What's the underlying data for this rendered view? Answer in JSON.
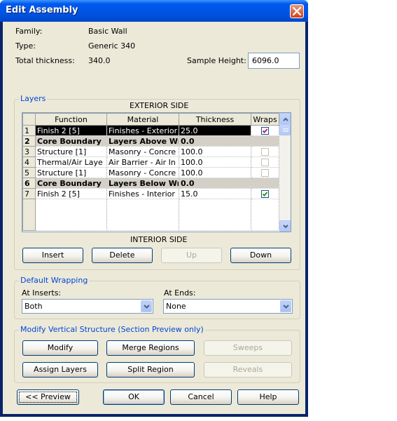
{
  "window": {
    "title": "Edit Assembly"
  },
  "info": {
    "family_label": "Family:",
    "family_value": "Basic Wall",
    "type_label": "Type:",
    "type_value": "Generic 340",
    "thickness_label": "Total thickness:",
    "thickness_value": "340.0",
    "sample_height_label": "Sample Height:",
    "sample_height_value": "6096.0"
  },
  "layers": {
    "group_title": "Layers",
    "exterior_label": "EXTERIOR SIDE",
    "interior_label": "INTERIOR SIDE",
    "columns": [
      "Function",
      "Material",
      "Thickness",
      "Wraps"
    ],
    "rows": [
      {
        "num": "1",
        "function": "Finish 2 [5]",
        "material": "Finishes - Exterior",
        "thickness": "25.0",
        "wraps": true,
        "wraps_enabled": true,
        "selected": true
      },
      {
        "num": "2",
        "function": "Core Boundary",
        "material": "Layers Above Wr",
        "thickness": "0.0",
        "boundary": true
      },
      {
        "num": "3",
        "function": "Structure [1]",
        "material": "Masonry - Concre",
        "thickness": "100.0",
        "wraps": false,
        "wraps_enabled": false
      },
      {
        "num": "4",
        "function": "Thermal/Air Laye",
        "material": "Air Barrier - Air In",
        "thickness": "100.0",
        "wraps": false,
        "wraps_enabled": false
      },
      {
        "num": "5",
        "function": "Structure [1]",
        "material": "Masonry - Concre",
        "thickness": "100.0",
        "wraps": false,
        "wraps_enabled": false
      },
      {
        "num": "6",
        "function": "Core Boundary",
        "material": "Layers Below Wra",
        "thickness": "0.0",
        "boundary": true
      },
      {
        "num": "7",
        "function": "Finish 2 [5]",
        "material": "Finishes - Interior",
        "thickness": "15.0",
        "wraps": true,
        "wraps_enabled": true
      }
    ],
    "buttons": {
      "insert": "Insert",
      "delete": "Delete",
      "up": "Up",
      "down": "Down"
    }
  },
  "wrapping": {
    "group_title": "Default Wrapping",
    "at_inserts_label": "At Inserts:",
    "at_inserts_value": "Both",
    "at_ends_label": "At Ends:",
    "at_ends_value": "None"
  },
  "vertical": {
    "group_title": "Modify Vertical Structure (Section Preview only)",
    "buttons": {
      "modify": "Modify",
      "merge": "Merge Regions",
      "sweeps": "Sweeps",
      "assign": "Assign Layers",
      "split": "Split Region",
      "reveals": "Reveals"
    }
  },
  "footer": {
    "preview": "<< Preview",
    "ok": "OK",
    "cancel": "Cancel",
    "help": "Help"
  },
  "colors": {
    "title_bar": "#0054e3",
    "dialog_bg": "#ece9d8",
    "group_title": "#0046d5",
    "selected_row": "#000000"
  }
}
